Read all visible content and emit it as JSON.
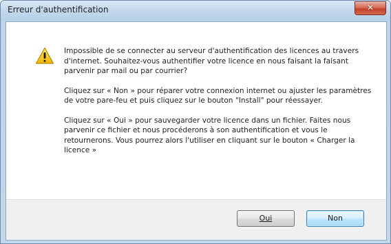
{
  "window": {
    "title": "Erreur d'authentification",
    "close_icon": "close-icon"
  },
  "dialog": {
    "icon": "warning-icon",
    "paragraphs": [
      "Impossible de se connecter au serveur d'authentification des licences au travers d'internet. Souhaitez-vous authentifier votre licence en nous faisant la faisant parvenir par mail ou par courrier?",
      "Cliquez sur « Non » pour réparer votre connexion internet ou ajuster les paramètres de votre pare-feu et puis cliquez sur le bouton \"Install\" pour réessayer.",
      "Cliquez sur « Oui » pour sauvegarder votre licence dans un fichier. Faites nous parvenir ce fichier et  nous procéderons à son authentification et vous le retournerons. Vous pourrez alors l'utiliser en cliquant sur le bouton « Charger la licence »"
    ]
  },
  "buttons": {
    "oui_label": "Oui",
    "non_label": "Non"
  },
  "colors": {
    "title_bar": "#c6daee",
    "close_button": "#c2412b",
    "default_button_border": "#3c7fb1",
    "warning_yellow": "#f5c400"
  }
}
